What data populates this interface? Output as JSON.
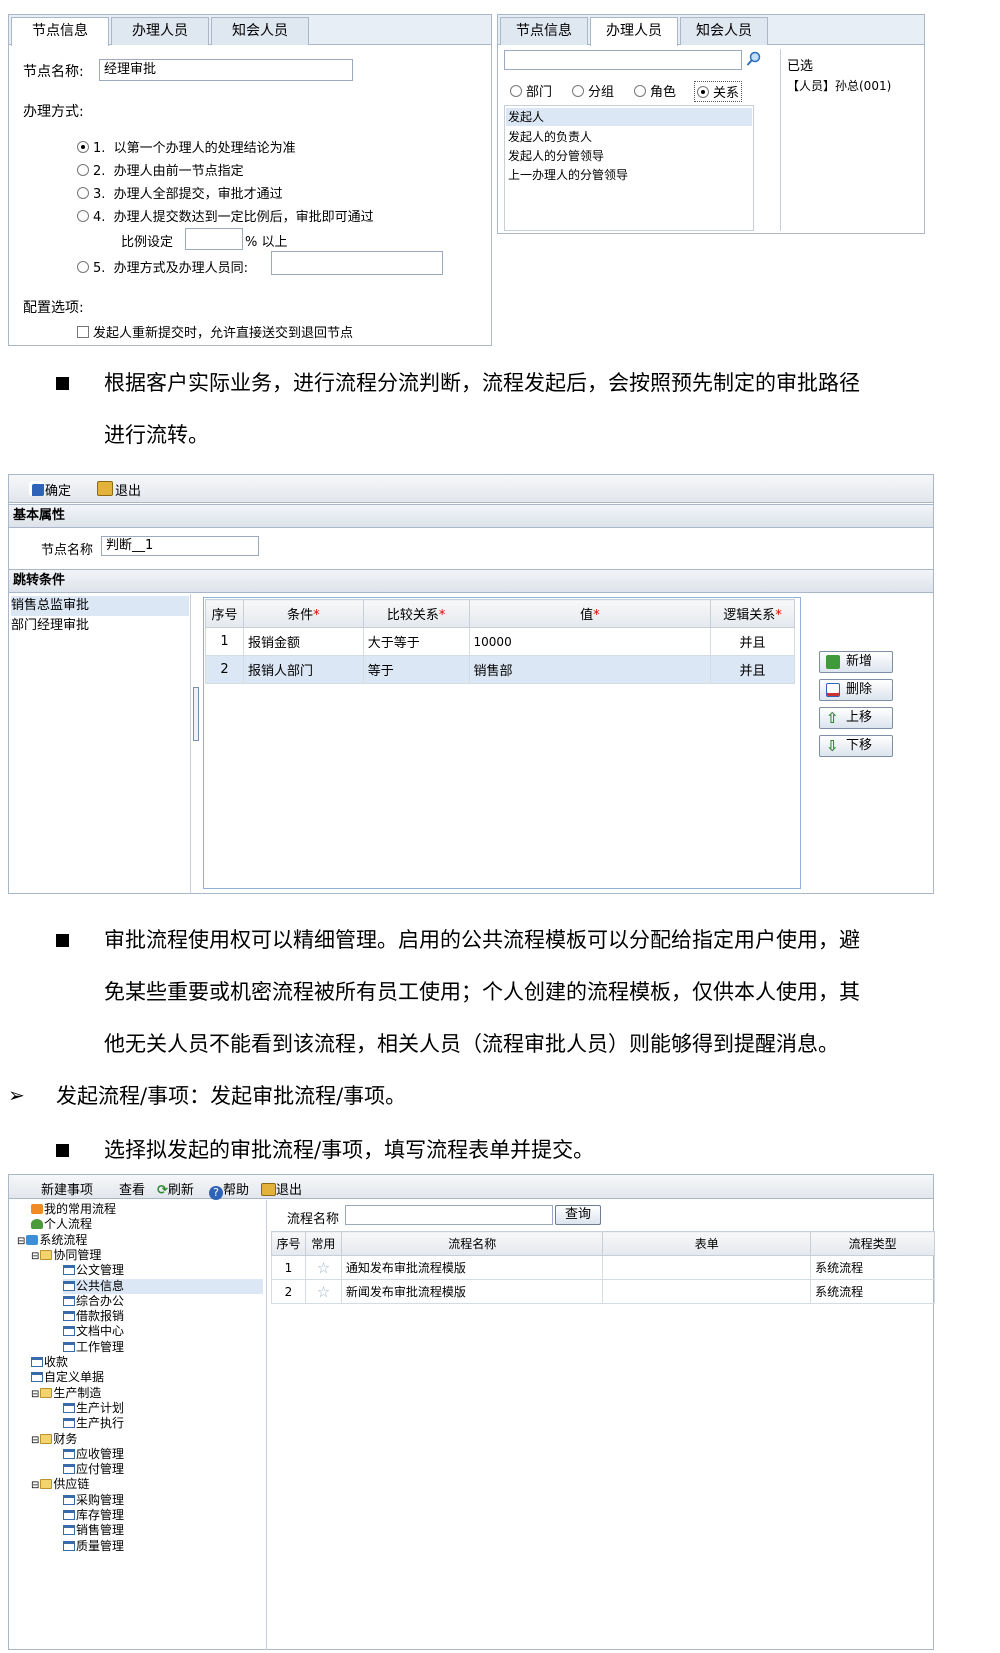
{
  "panel1": {
    "tabs": [
      "节点信息",
      "办理人员",
      "知会人员"
    ],
    "node_name_label": "节点名称:",
    "node_name_value": "经理审批",
    "mode_label": "办理方式:",
    "options": [
      {
        "num": "1.",
        "label": "以第一个办理人的处理结论为准",
        "selected": true
      },
      {
        "num": "2.",
        "label": "办理人由前一节点指定",
        "selected": false
      },
      {
        "num": "3.",
        "label": "办理人全部提交，审批才通过",
        "selected": false
      },
      {
        "num": "4.",
        "label": "办理人提交数达到一定比例后，审批即可通过",
        "selected": false
      },
      {
        "num": "5.",
        "label": "办理方式及办理人员同:",
        "selected": false
      }
    ],
    "ratio_label": "比例设定",
    "ratio_suffix": "% 以上",
    "config_label": "配置选项:",
    "config_option": "发起人重新提交时，允许直接送交到退回节点"
  },
  "panel2": {
    "tabs": [
      "节点信息",
      "办理人员",
      "知会人员"
    ],
    "radios": [
      {
        "label": "部门",
        "selected": false
      },
      {
        "label": "分组",
        "selected": false
      },
      {
        "label": "角色",
        "selected": false
      },
      {
        "label": "关系",
        "selected": true
      }
    ],
    "list": [
      "发起人",
      "发起人的负责人",
      "发起人的分管领导",
      "上一办理人的分管领导"
    ],
    "selected_title": "已选",
    "selected_items": [
      "【人员】孙总(001)"
    ]
  },
  "para1": {
    "line1": "根据客户实际业务，进行流程分流判断，流程发起后，会按照预先制定的审批路径",
    "line2": "进行流转。"
  },
  "panel3": {
    "toolbar": {
      "confirm": "确定",
      "exit": "退出"
    },
    "basic_title": "基本属性",
    "node_name_label": "节点名称",
    "node_name_value": "判断__1",
    "jump_title": "跳转条件",
    "branches": [
      "销售总监审批",
      "部门经理审批"
    ],
    "columns": {
      "seq": "序号",
      "cond": "条件",
      "compare": "比较关系",
      "value": "值",
      "logic": "逻辑关系"
    },
    "rows": [
      {
        "seq": "1",
        "cond": "报销金额",
        "compare": "大于等于",
        "value": "10000",
        "logic": "并且"
      },
      {
        "seq": "2",
        "cond": "报销人部门",
        "compare": "等于",
        "value": "销售部",
        "logic": "并且"
      }
    ],
    "buttons": {
      "add": "新增",
      "delete": "删除",
      "up": "上移",
      "down": "下移"
    }
  },
  "para2": {
    "line1": "审批流程使用权可以精细管理。启用的公共流程模板可以分配给指定用户使用，避",
    "line2": "免某些重要或机密流程被所有员工使用；个人创建的流程模板，仅供本人使用，其",
    "line3": "他无关人员不能看到该流程，相关人员（流程审批人员）则能够得到提醒消息。"
  },
  "heading": {
    "arrow": "➢",
    "text": "发起流程/事项：发起审批流程/事项。"
  },
  "para3": {
    "line1": "选择拟发起的审批流程/事项，填写流程表单并提交。"
  },
  "panel4": {
    "toolbar": {
      "new": "新建事项",
      "view": "查看",
      "refresh": "刷新",
      "help": "帮助",
      "exit": "退出"
    },
    "tree": [
      {
        "label": "我的常用流程",
        "level": 1,
        "icon": "rss"
      },
      {
        "label": "个人流程",
        "level": 1,
        "icon": "person"
      },
      {
        "label": "系统流程",
        "level": 0,
        "icon": "system"
      },
      {
        "label": "协同管理",
        "level": 1,
        "icon": "folder"
      },
      {
        "label": "公文管理",
        "level": 2,
        "icon": "doc"
      },
      {
        "label": "公共信息",
        "level": 2,
        "icon": "doc"
      },
      {
        "label": "综合办公",
        "level": 2,
        "icon": "doc"
      },
      {
        "label": "借款报销",
        "level": 2,
        "icon": "doc"
      },
      {
        "label": "文档中心",
        "level": 2,
        "icon": "doc"
      },
      {
        "label": "工作管理",
        "level": 2,
        "icon": "doc"
      },
      {
        "label": "收款",
        "level": 1,
        "icon": "doc"
      },
      {
        "label": "自定义单据",
        "level": 1,
        "icon": "doc"
      },
      {
        "label": "生产制造",
        "level": 1,
        "icon": "folder"
      },
      {
        "label": "生产计划",
        "level": 2,
        "icon": "doc"
      },
      {
        "label": "生产执行",
        "level": 2,
        "icon": "doc"
      },
      {
        "label": "财务",
        "level": 1,
        "icon": "folder"
      },
      {
        "label": "应收管理",
        "level": 2,
        "icon": "doc"
      },
      {
        "label": "应付管理",
        "level": 2,
        "icon": "doc"
      },
      {
        "label": "供应链",
        "level": 1,
        "icon": "folder"
      },
      {
        "label": "采购管理",
        "level": 2,
        "icon": "doc"
      },
      {
        "label": "库存管理",
        "level": 2,
        "icon": "doc"
      },
      {
        "label": "销售管理",
        "level": 2,
        "icon": "doc"
      },
      {
        "label": "质量管理",
        "level": 2,
        "icon": "doc"
      }
    ],
    "search_label": "流程名称",
    "search_button": "查询",
    "columns": {
      "seq": "序号",
      "fav": "常用",
      "name": "流程名称",
      "form": "表单",
      "type": "流程类型"
    },
    "rows": [
      {
        "seq": "1",
        "name": "通知发布审批流程模版",
        "form": "",
        "type": "系统流程"
      },
      {
        "seq": "2",
        "name": "新闻发布审批流程模版",
        "form": "",
        "type": "系统流程"
      }
    ]
  }
}
